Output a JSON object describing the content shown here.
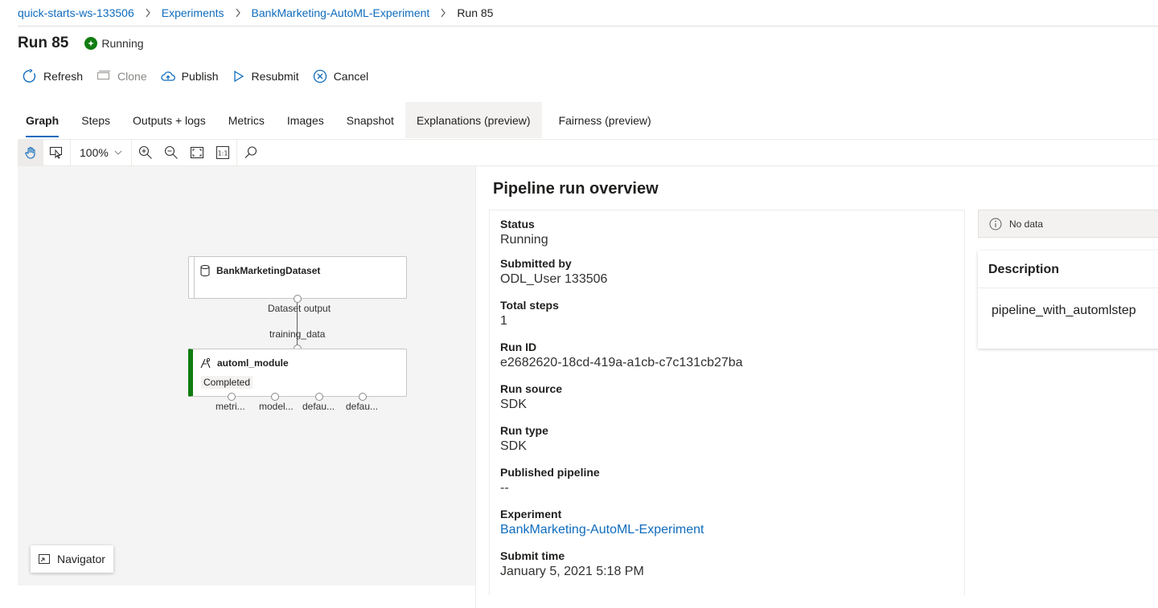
{
  "breadcrumb": {
    "items": [
      "quick-starts-ws-133506",
      "Experiments",
      "BankMarketing-AutoML-Experiment"
    ],
    "current": "Run 85"
  },
  "header": {
    "title": "Run 85",
    "status": "Running"
  },
  "toolbar": {
    "refresh": "Refresh",
    "clone": "Clone",
    "publish": "Publish",
    "resubmit": "Resubmit",
    "cancel": "Cancel"
  },
  "tabs": [
    {
      "label": "Graph",
      "active": true
    },
    {
      "label": "Steps"
    },
    {
      "label": "Outputs + logs"
    },
    {
      "label": "Metrics"
    },
    {
      "label": "Images"
    },
    {
      "label": "Snapshot"
    },
    {
      "label": "Explanations (preview)"
    },
    {
      "label": "Fairness (preview)"
    }
  ],
  "graph_toolbar": {
    "zoom": "100%"
  },
  "graph": {
    "dataset_node": {
      "title": "BankMarketingDataset",
      "output_label": "Dataset output"
    },
    "edge_label": "training_data",
    "module_node": {
      "title": "automl_module",
      "status": "Completed",
      "outputs": [
        "metri...",
        "model...",
        "defau...",
        "defau..."
      ]
    },
    "navigator": "Navigator"
  },
  "overview": {
    "title": "Pipeline run overview",
    "fields": [
      {
        "label": "Status",
        "value": "Running"
      },
      {
        "label": "Submitted by",
        "value": "ODL_User 133506"
      },
      {
        "label": "Total steps",
        "value": "1"
      },
      {
        "label": "Run ID",
        "value": "e2682620-18cd-419a-a1cb-c7c131cb27ba"
      },
      {
        "label": "Run source",
        "value": "SDK"
      },
      {
        "label": "Run type",
        "value": "SDK"
      },
      {
        "label": "Published pipeline",
        "value": "--"
      },
      {
        "label": "Experiment",
        "value": "BankMarketing-AutoML-Experiment"
      },
      {
        "label": "Submit time",
        "value": "January 5, 2021 5:18 PM"
      }
    ],
    "no_data": "No data",
    "description": {
      "heading": "Description",
      "text": "pipeline_with_automlstep"
    }
  },
  "colors": {
    "accent": "#0f6cbd",
    "success": "#107c10"
  }
}
